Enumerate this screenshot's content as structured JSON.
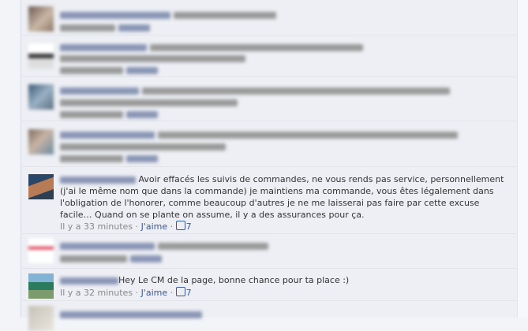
{
  "comments": [
    {
      "id": 5,
      "text": "Avoir effacés les suivis de commandes, ne vous rends pas service, personnellement (j'ai le même nom que dans la commande) je maintiens ma commande, vous êtes légalement dans l'obligation de l'honorer, comme beaucoup d'autres je ne me laisserai pas faire par cette excuse facile… Quand on se plante on assume, il y a des assurances pour ça.",
      "time": "Il y a 33 minutes",
      "like": "J'aime",
      "sep": "·",
      "likes": "7"
    },
    {
      "id": 7,
      "text": "Hey Le CM de la page, bonne chance pour ta place :)",
      "time": "Il y a 32 minutes",
      "like": "J'aime",
      "sep": "·",
      "likes": "7"
    }
  ]
}
